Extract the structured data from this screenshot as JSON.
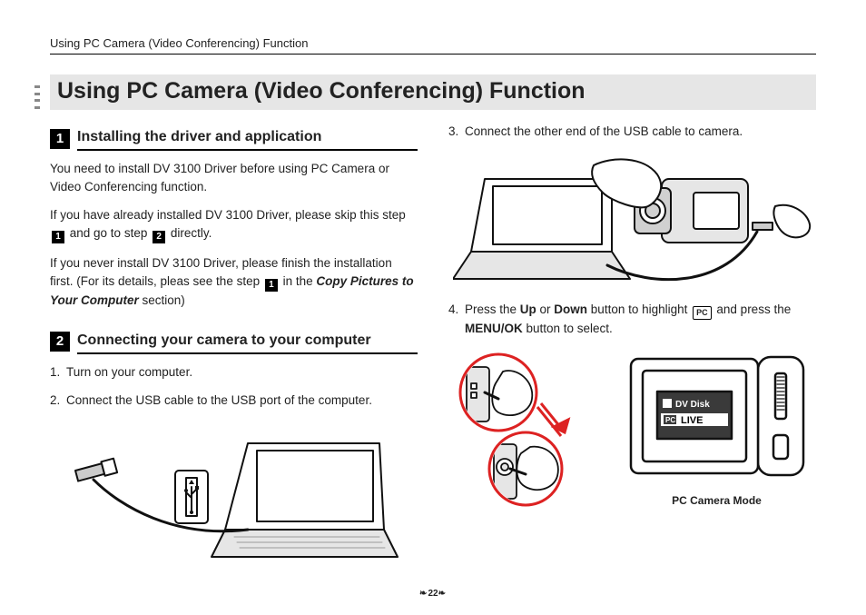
{
  "running_head": "Using PC Camera (Video Conferencing) Function",
  "chapter_title": "Using PC Camera (Video Conferencing) Function",
  "page_number": "22",
  "section1": {
    "badge": "1",
    "title": "Installing the driver and application",
    "para1": "You need to install DV 3100 Driver before using PC Camera or Video Conferencing function.",
    "para2_a": "If you have already installed DV 3100 Driver, please skip this step",
    "para2_badge1": "1",
    "para2_b": " and go to step ",
    "para2_badge2": "2",
    "para2_c": " directly.",
    "para3_a": "If you never install DV 3100 Driver, please finish the installation first. (For its details, pleas see the step ",
    "para3_badge": "1",
    "para3_b": " in the ",
    "para3_ref": "Copy Pictures to Your Computer",
    "para3_c": " section)"
  },
  "section2": {
    "badge": "2",
    "title": "Connecting your camera to your computer",
    "step1_num": "1.",
    "step1": "Turn on your computer.",
    "step2_num": "2.",
    "step2": "Connect the USB cable to the USB port of the computer."
  },
  "right": {
    "step3_num": "3.",
    "step3": "Connect the other end of the USB cable to camera.",
    "step4_num": "4.",
    "step4_a": "Press the ",
    "step4_up": "Up",
    "step4_b": " or ",
    "step4_down": "Down",
    "step4_c": " button to highlight ",
    "step4_pc": "PC",
    "step4_d": " and press the ",
    "step4_menu": "MENU/OK",
    "step4_e": " button to select.",
    "lcd_dvdisk": "DV Disk",
    "lcd_live": "LIVE",
    "lcd_pc": "PC",
    "caption": "PC Camera Mode"
  }
}
